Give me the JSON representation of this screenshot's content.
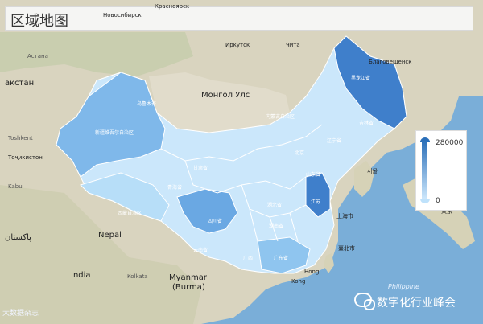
{
  "title": "区域地图",
  "legend": {
    "max": "280000",
    "min": "0"
  },
  "colors": {
    "ocean": "#7aaed8",
    "land": "#d9d4bf",
    "china_dark": "#3f7fcb",
    "china_mid": "#7fb8ea",
    "china_light": "#cbe7fb"
  },
  "labels": {
    "mongolia": "Монгол Улс",
    "irkutsk": "Иркутск",
    "chita": "Чита",
    "blago": "Благовещенск",
    "astana": "Астана",
    "kazakhstan": "ақстан",
    "toshkent": "Toshkent",
    "tochikiston": "Тоҷикистон",
    "kabul": "Kabul",
    "pakistan": "پاکستان",
    "india": "India",
    "nepal": "Nepal",
    "kolkata": "Kolkata",
    "myanmar1": "Myanmar",
    "myanmar2": "(Burma)",
    "novosibirsk": "Новосибирск",
    "krasnoyarsk": "Красноярск",
    "shanghai": "上海市",
    "hongkong": "Hong",
    "kong": "Kong",
    "philippine": "Philippine",
    "taipei": "臺北市",
    "seoul": "서울",
    "tokyo": "東京",
    "urumqi": "乌鲁木齐",
    "heilongjiang": "黑龙江省",
    "xinjiang": "新疆维吾尔自治区",
    "xizang": "西藏自治区",
    "qinghai": "青海省",
    "sichuan": "四川省",
    "gansu": "甘肃省",
    "neimenggu": "内蒙古自治区",
    "beijing": "北京",
    "shandong": "山东省",
    "jiangsu": "江苏",
    "hubei": "湖北省",
    "hunan": "湖南省",
    "guangxi": "广西",
    "guangdong": "广东省",
    "yunnan": "云南省",
    "jilin": "吉林省",
    "liaoning": "辽宁省"
  },
  "watermark": "数字化行业峰会",
  "bottom_left": "大数据杂志"
}
